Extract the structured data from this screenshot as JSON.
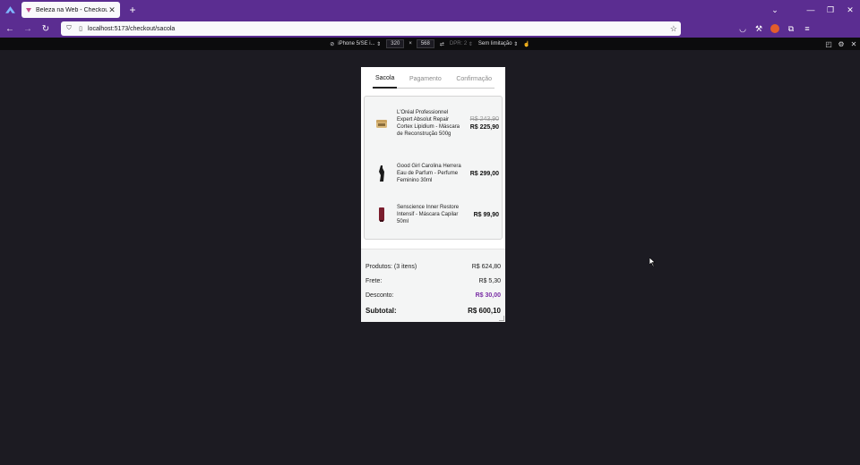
{
  "browser": {
    "tab_title": "Beleza na Web - Checkout",
    "url": "localhost:5173/checkout/sacola",
    "colors": {
      "chrome": "#5b2d91",
      "content_bg": "#1c1b22"
    }
  },
  "devtools": {
    "device": "iPhone 5/SE i...",
    "width": "320",
    "times": "×",
    "height": "568",
    "dpr": "DPR: 2",
    "throttling": "Sem limitação"
  },
  "checkout": {
    "steps": [
      {
        "label": "Sacola",
        "active": true
      },
      {
        "label": "Pagamento",
        "active": false
      },
      {
        "label": "Confirmação",
        "active": false
      }
    ],
    "products": [
      {
        "name": "L'Oréal Professionnel Expert Absolut Repair Cortex Lipidium - Máscara de Reconstrução 500g",
        "old_price": "R$ 243,90",
        "price": "R$ 225,90",
        "thumb_icon": "cream-jar-icon"
      },
      {
        "name": "Good Girl Carolina Herrera Eau de Parfum - Perfume Feminino 30ml",
        "price": "R$ 299,00",
        "thumb_icon": "perfume-bottle-icon"
      },
      {
        "name": "Senscience Inner Restore Intensif - Máscara Capilar 50ml",
        "price": "R$ 99,90",
        "thumb_icon": "tube-icon"
      }
    ],
    "summary": {
      "products_label": "Produtos: (3 itens)",
      "products_value": "R$ 624,80",
      "shipping_label": "Frete:",
      "shipping_value": "R$ 5,30",
      "discount_label": "Desconto:",
      "discount_value": "R$ 30,00",
      "subtotal_label": "Subtotal:",
      "subtotal_value": "R$ 600,10",
      "accent_color": "#7a2ea5"
    }
  }
}
